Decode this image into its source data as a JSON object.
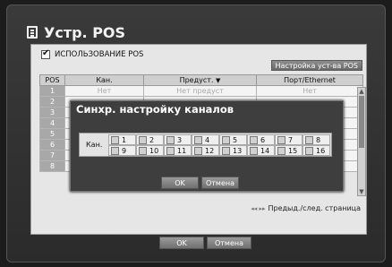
{
  "title": "Устр. POS",
  "use_pos_label": "ИСПОЛЬЗОВАНИЕ POS",
  "settings_button": "Настройка уст-ва POS",
  "columns": [
    "POS",
    "Кан.",
    "Предуст.",
    "Порт/Ethernet"
  ],
  "rows": [
    {
      "pos": "1",
      "ch": "Нет",
      "preset": "Нет предуст",
      "port": "Нет"
    },
    {
      "pos": "2",
      "ch": "",
      "preset": "",
      "port": ""
    },
    {
      "pos": "3",
      "ch": "",
      "preset": "",
      "port": ""
    },
    {
      "pos": "4",
      "ch": "",
      "preset": "",
      "port": ""
    },
    {
      "pos": "5",
      "ch": "",
      "preset": "",
      "port": ""
    },
    {
      "pos": "6",
      "ch": "",
      "preset": "",
      "port": ""
    },
    {
      "pos": "7",
      "ch": "",
      "preset": "",
      "port": ""
    },
    {
      "pos": "8",
      "ch": "",
      "preset": "...",
      "port": ""
    }
  ],
  "pager_hint": "Предыд./след. страница",
  "ok": "OK",
  "cancel": "Отмена",
  "modal": {
    "title": "Синхр. настройку каналов",
    "channel_label": "Кан.",
    "channels_row1": [
      "1",
      "2",
      "3",
      "4",
      "5",
      "6",
      "7",
      "8"
    ],
    "channels_row2": [
      "9",
      "10",
      "11",
      "12",
      "13",
      "14",
      "15",
      "16"
    ],
    "ok": "OK",
    "cancel": "Отмена"
  }
}
